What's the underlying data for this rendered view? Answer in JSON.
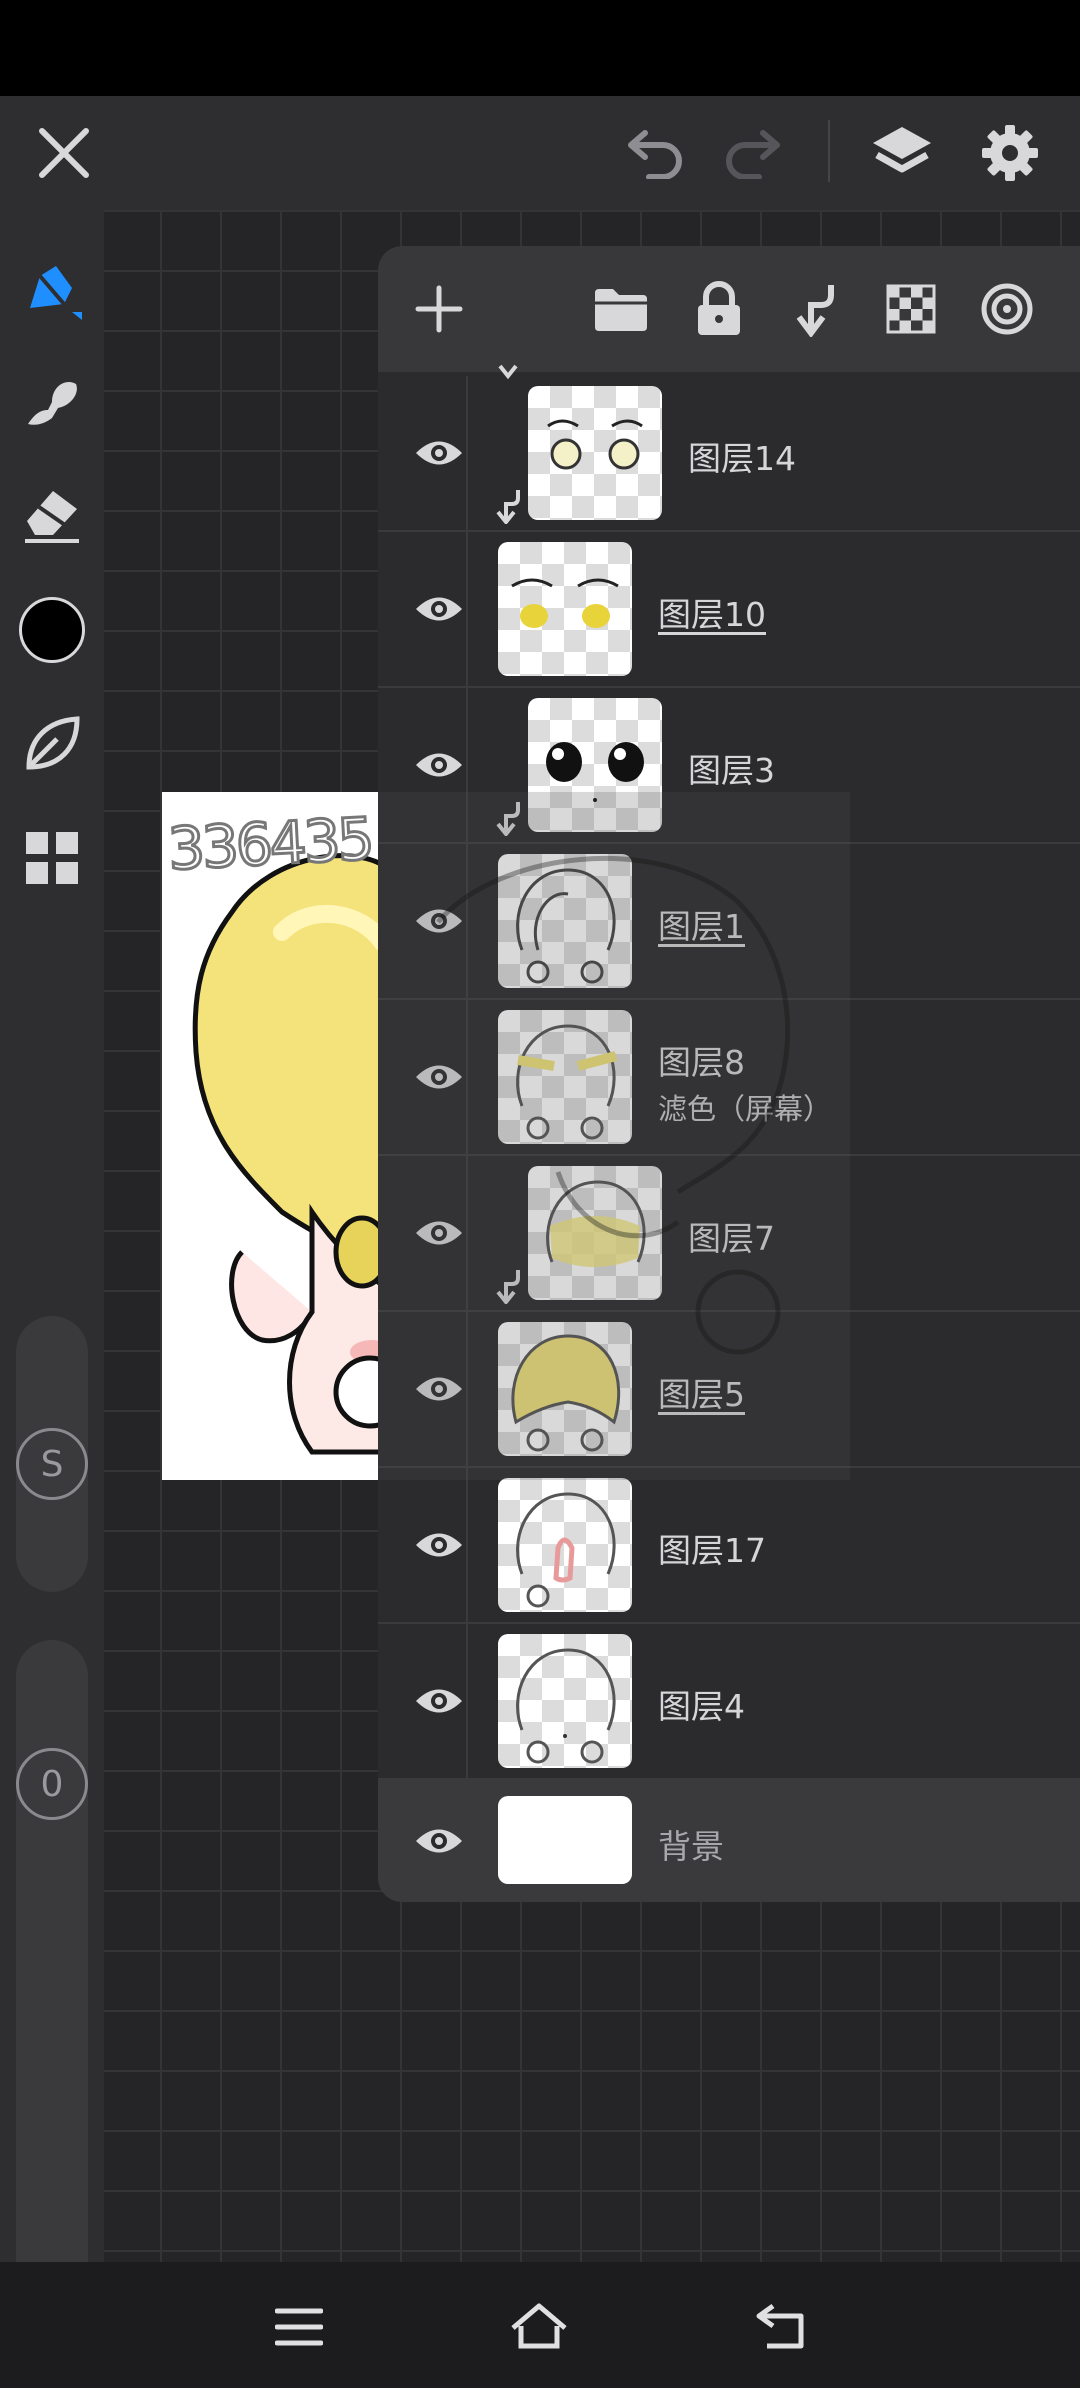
{
  "top_bar": {
    "close_icon": "close-icon",
    "undo_icon": "undo-icon",
    "redo_icon": "redo-icon",
    "layers_icon": "layers-icon",
    "settings_icon": "gear-icon"
  },
  "toolbar": {
    "tools": [
      "pen-icon",
      "smudge-icon",
      "eraser-icon",
      "color-swatch",
      "leaf-brush-icon",
      "grid-menu-icon"
    ],
    "current_color": "#000000",
    "accent_color": "#1f8fff",
    "size_slider_label": "S",
    "opacity_slider_label": "0"
  },
  "artwork": {
    "id_text": "336435"
  },
  "layer_panel": {
    "toolbar": [
      "add-layer-icon",
      "folder-icon",
      "lock-icon",
      "clip-icon",
      "transparency-lock-icon",
      "blend-target-icon"
    ],
    "layers": [
      {
        "name": "图层14",
        "sub": "",
        "underlined": false,
        "clipped": true
      },
      {
        "name": "图层10",
        "sub": "",
        "underlined": true,
        "clipped": false
      },
      {
        "name": "图层3",
        "sub": "",
        "underlined": false,
        "clipped": true
      },
      {
        "name": "图层1",
        "sub": "",
        "underlined": true,
        "clipped": false
      },
      {
        "name": "图层8",
        "sub": "滤色（屏幕）",
        "underlined": false,
        "clipped": false
      },
      {
        "name": "图层7",
        "sub": "",
        "underlined": false,
        "clipped": true
      },
      {
        "name": "图层5",
        "sub": "",
        "underlined": true,
        "clipped": false
      },
      {
        "name": "图层17",
        "sub": "",
        "underlined": false,
        "clipped": false
      },
      {
        "name": "图层4",
        "sub": "",
        "underlined": false,
        "clipped": false
      },
      {
        "name": "背景",
        "sub": "",
        "underlined": false,
        "clipped": false
      }
    ]
  },
  "nav_bar": {
    "menu_icon": "menu-icon",
    "home_icon": "home-icon",
    "back_icon": "back-icon"
  }
}
